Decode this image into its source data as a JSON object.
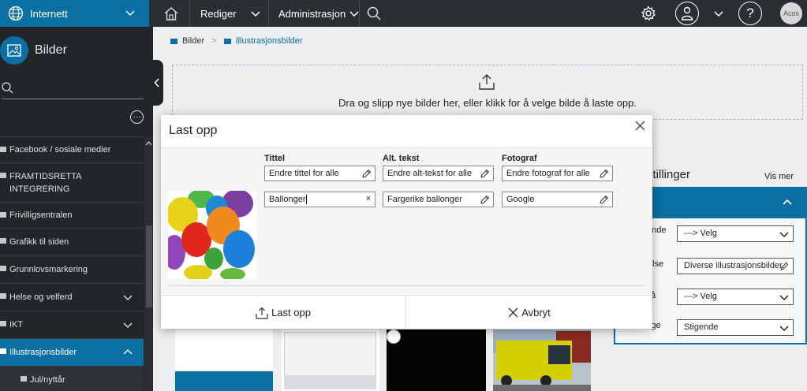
{
  "topbar": {
    "site": "Internett",
    "menu_edit": "Rediger",
    "menu_admin": "Administrasjon",
    "avatar_text": "Acos"
  },
  "sidebar": {
    "title": "Bilder",
    "search_placeholder": "",
    "more_glyph": "···",
    "items": [
      {
        "label": "Facebook / sosiale medier",
        "expandable": false
      },
      {
        "label": "FRAMTIDSRETTA INTEGRERING",
        "expandable": false
      },
      {
        "label": "Frivilligsentralen",
        "expandable": false
      },
      {
        "label": "Grafikk til siden",
        "expandable": false
      },
      {
        "label": "Grunnlovsmarkering",
        "expandable": false
      },
      {
        "label": "Helse og velferd",
        "expandable": true
      },
      {
        "label": "IKT",
        "expandable": true
      },
      {
        "label": "Illustrasjonsbilder",
        "expandable": true,
        "active": true
      },
      {
        "label": "Jul/nyttår",
        "sub": true
      }
    ]
  },
  "breadcrumb": [
    "Bilder",
    "Illustrasjonsbilder"
  ],
  "breadcrumb_sep": ">",
  "dropzone": {
    "text": "Dra og slipp nye bilder her, eller klikk for å velge bilde å laste opp."
  },
  "right_panel": {
    "title_fragment": "stillinger",
    "vis_mer": "Vis mer",
    "rows": [
      {
        "label_fragment": "ende",
        "value": "---> Velg",
        "type": "select"
      },
      {
        "label_fragment": "lse",
        "value": "Diverse illustrasjonsbilder.",
        "type": "edit"
      },
      {
        "label_fragment": "å",
        "value": "---> Velg",
        "type": "select"
      },
      {
        "label_fragment": "ige",
        "value": "Stigende",
        "type": "select"
      }
    ]
  },
  "modal": {
    "title": "Last opp",
    "close_glyph": "×",
    "columns": [
      "Tittel",
      "Alt. tekst",
      "Fotograf"
    ],
    "bulk": {
      "title_placeholder": "Endre tittel for alle",
      "alt_placeholder": "Endre alt-tekst for alle",
      "photographer_placeholder": "Endre fotograf for alle"
    },
    "image_row": {
      "title": "Ballonger",
      "alt": "Fargerike ballonger",
      "photographer": "Google",
      "clear_glyph": "×"
    },
    "upload_button": "Last opp",
    "cancel_button": "Avbryt"
  },
  "colors": {
    "brand": "#0b6fa4",
    "topbar": "#2b2f33",
    "sidebar": "#232629"
  }
}
